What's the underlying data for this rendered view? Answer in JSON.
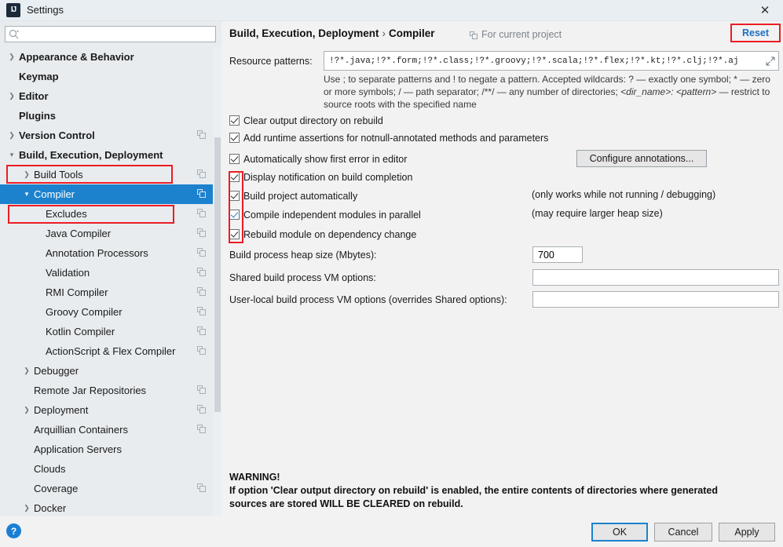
{
  "window": {
    "title": "Settings",
    "logo_text": "IJ",
    "close_icon": "✕"
  },
  "sidebar": {
    "search": {
      "placeholder": "",
      "value": "",
      "icon": "search-icon"
    },
    "items": [
      {
        "label": "Appearance & Behavior",
        "level": 0,
        "arrow": "collapsed",
        "bold": true,
        "copy": false,
        "selected": false
      },
      {
        "label": "Keymap",
        "level": 0,
        "arrow": "none",
        "bold": true,
        "copy": false,
        "selected": false
      },
      {
        "label": "Editor",
        "level": 0,
        "arrow": "collapsed",
        "bold": true,
        "copy": false,
        "selected": false
      },
      {
        "label": "Plugins",
        "level": 0,
        "arrow": "none",
        "bold": true,
        "copy": false,
        "selected": false
      },
      {
        "label": "Version Control",
        "level": 0,
        "arrow": "collapsed",
        "bold": true,
        "copy": true,
        "selected": false
      },
      {
        "label": "Build, Execution, Deployment",
        "level": 0,
        "arrow": "expanded",
        "bold": true,
        "copy": false,
        "selected": false
      },
      {
        "label": "Build Tools",
        "level": 1,
        "arrow": "collapsed",
        "bold": false,
        "copy": true,
        "selected": false
      },
      {
        "label": "Compiler",
        "level": 1,
        "arrow": "expanded",
        "bold": false,
        "copy": true,
        "selected": true
      },
      {
        "label": "Excludes",
        "level": 2,
        "arrow": "none",
        "bold": false,
        "copy": true,
        "selected": false
      },
      {
        "label": "Java Compiler",
        "level": 2,
        "arrow": "none",
        "bold": false,
        "copy": true,
        "selected": false
      },
      {
        "label": "Annotation Processors",
        "level": 2,
        "arrow": "none",
        "bold": false,
        "copy": true,
        "selected": false
      },
      {
        "label": "Validation",
        "level": 2,
        "arrow": "none",
        "bold": false,
        "copy": true,
        "selected": false
      },
      {
        "label": "RMI Compiler",
        "level": 2,
        "arrow": "none",
        "bold": false,
        "copy": true,
        "selected": false
      },
      {
        "label": "Groovy Compiler",
        "level": 2,
        "arrow": "none",
        "bold": false,
        "copy": true,
        "selected": false
      },
      {
        "label": "Kotlin Compiler",
        "level": 2,
        "arrow": "none",
        "bold": false,
        "copy": true,
        "selected": false
      },
      {
        "label": "ActionScript & Flex Compiler",
        "level": 2,
        "arrow": "none",
        "bold": false,
        "copy": true,
        "selected": false
      },
      {
        "label": "Debugger",
        "level": 1,
        "arrow": "collapsed",
        "bold": false,
        "copy": false,
        "selected": false
      },
      {
        "label": "Remote Jar Repositories",
        "level": 1,
        "arrow": "none",
        "bold": false,
        "copy": true,
        "selected": false
      },
      {
        "label": "Deployment",
        "level": 1,
        "arrow": "collapsed",
        "bold": false,
        "copy": true,
        "selected": false
      },
      {
        "label": "Arquillian Containers",
        "level": 1,
        "arrow": "none",
        "bold": false,
        "copy": true,
        "selected": false
      },
      {
        "label": "Application Servers",
        "level": 1,
        "arrow": "none",
        "bold": false,
        "copy": false,
        "selected": false
      },
      {
        "label": "Clouds",
        "level": 1,
        "arrow": "none",
        "bold": false,
        "copy": false,
        "selected": false
      },
      {
        "label": "Coverage",
        "level": 1,
        "arrow": "none",
        "bold": false,
        "copy": true,
        "selected": false
      },
      {
        "label": "Docker",
        "level": 1,
        "arrow": "collapsed",
        "bold": false,
        "copy": false,
        "selected": false
      }
    ]
  },
  "content": {
    "breadcrumb_parent": "Build, Execution, Deployment",
    "breadcrumb_sep": "›",
    "breadcrumb_current": "Compiler",
    "for_current_project": "For current project",
    "reset_label": "Reset",
    "resource_patterns_label": "Resource patterns:",
    "resource_patterns_value": "!?*.java;!?*.form;!?*.class;!?*.groovy;!?*.scala;!?*.flex;!?*.kt;!?*.clj;!?*.aj",
    "resource_patterns_hint_line1": "Use ; to separate patterns and ! to negate a pattern. Accepted wildcards: ? — exactly one symbol; * — zero",
    "resource_patterns_hint_line2a": "or more symbols; / — path separator; /**/ — any number of directories; ",
    "resource_patterns_hint_line2b": "<dir_name>: <pattern>",
    "resource_patterns_hint_line2c": " — restrict",
    "resource_patterns_hint_line3": "to source roots with the specified name",
    "expand_icon": "⤢",
    "checkboxes": [
      {
        "label": "Clear output directory on rebuild",
        "checked": true,
        "focused": false
      },
      {
        "label": "Add runtime assertions for notnull-annotated methods and parameters",
        "checked": true,
        "focused": false
      },
      {
        "label": "Automatically show first error in editor",
        "checked": true,
        "focused": false
      },
      {
        "label": "Display notification on build completion",
        "checked": true,
        "focused": false
      },
      {
        "label": "Build project automatically",
        "checked": true,
        "focused": false
      },
      {
        "label": "Compile independent modules in parallel",
        "checked": true,
        "focused": true
      },
      {
        "label": "Rebuild module on dependency change",
        "checked": true,
        "focused": false
      }
    ],
    "configure_annotations_button": "Configure annotations...",
    "note_build_project": "(only works while not running / debugging)",
    "note_compile_parallel": "(may require larger heap size)",
    "heap_label": "Build process heap size (Mbytes):",
    "heap_value": "700",
    "shared_vm_label": "Shared build process VM options:",
    "shared_vm_value": "",
    "userlocal_vm_label": "User-local build process VM options (overrides Shared options):",
    "userlocal_vm_value": "",
    "warning_title": "WARNING!",
    "warning_line1": "If option 'Clear output directory on rebuild' is enabled, the entire contents of directories where generated",
    "warning_line2": "sources are stored WILL BE CLEARED on rebuild."
  },
  "footer": {
    "help_icon": "?",
    "ok_label": "OK",
    "cancel_label": "Cancel",
    "apply_label": "Apply"
  },
  "colors": {
    "accent_blue": "#1d82cd",
    "link_blue": "#1a6fc4",
    "highlight_red": "#ec1c24",
    "panel_bg": "#e8ecef",
    "content_bg": "#f2f2f2"
  }
}
